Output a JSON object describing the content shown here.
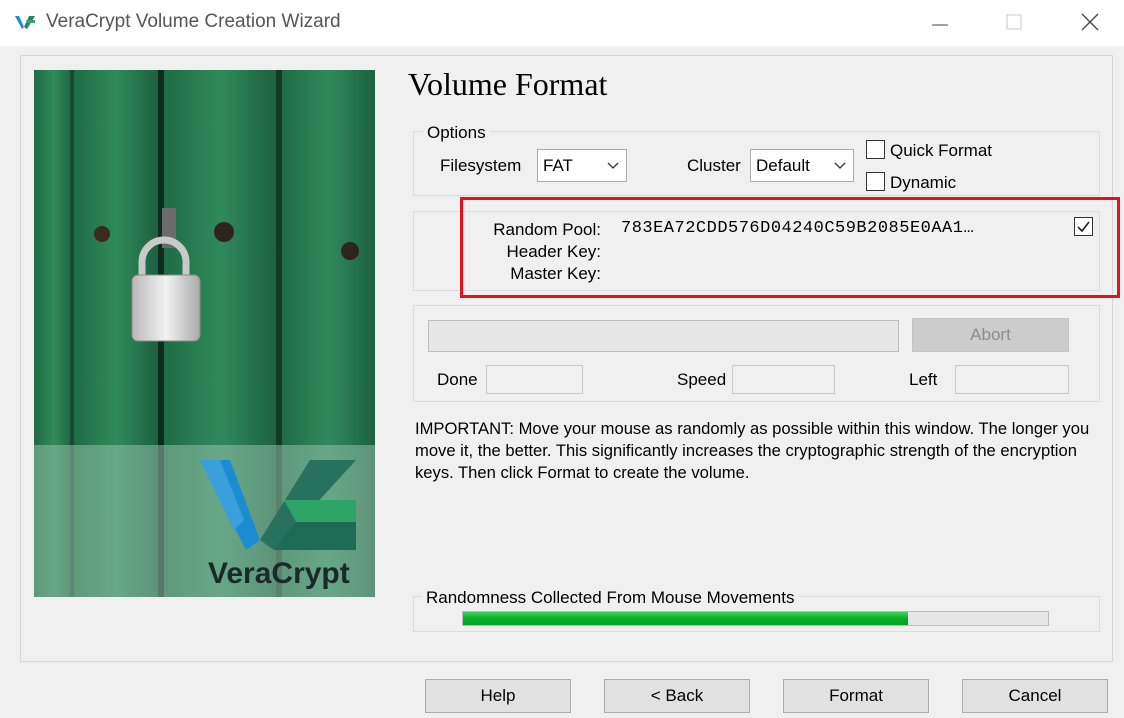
{
  "window": {
    "title": "VeraCrypt Volume Creation Wizard"
  },
  "side_image": {
    "brand_text": "VeraCrypt"
  },
  "page_title": "Volume Format",
  "options": {
    "legend": "Options",
    "filesystem_label": "Filesystem",
    "filesystem_value": "FAT",
    "cluster_label": "Cluster",
    "cluster_value": "Default",
    "quick_format_label": "Quick Format",
    "quick_format_checked": false,
    "dynamic_label": "Dynamic",
    "dynamic_checked": false
  },
  "keys": {
    "random_pool_label": "Random Pool:",
    "random_pool_value": "783EA72CDD576D04240C59B2085E0AA1…",
    "header_key_label": "Header Key:",
    "master_key_label": "Master Key:",
    "show_keys_checked": true
  },
  "progress": {
    "abort_label": "Abort",
    "done_label": "Done",
    "speed_label": "Speed",
    "left_label": "Left"
  },
  "important_text": "IMPORTANT: Move your mouse as randomly as possible within this window. The longer you move it, the better. This significantly increases the cryptographic strength of the encryption keys. Then click Format to create the volume.",
  "randomness": {
    "legend": "Randomness Collected From Mouse Movements",
    "fraction": 0.76
  },
  "buttons": {
    "help": "Help",
    "back": "< Back",
    "format": "Format",
    "cancel": "Cancel"
  },
  "colors": {
    "highlight": "#e0131f",
    "progress_green": "#06b025"
  },
  "icons": {
    "app": "veracrypt-logo-icon",
    "minimize": "minimize-icon",
    "maximize": "maximize-icon",
    "close": "close-icon",
    "combo": "chevron-down-icon",
    "checkbox": "checkmark-icon"
  }
}
